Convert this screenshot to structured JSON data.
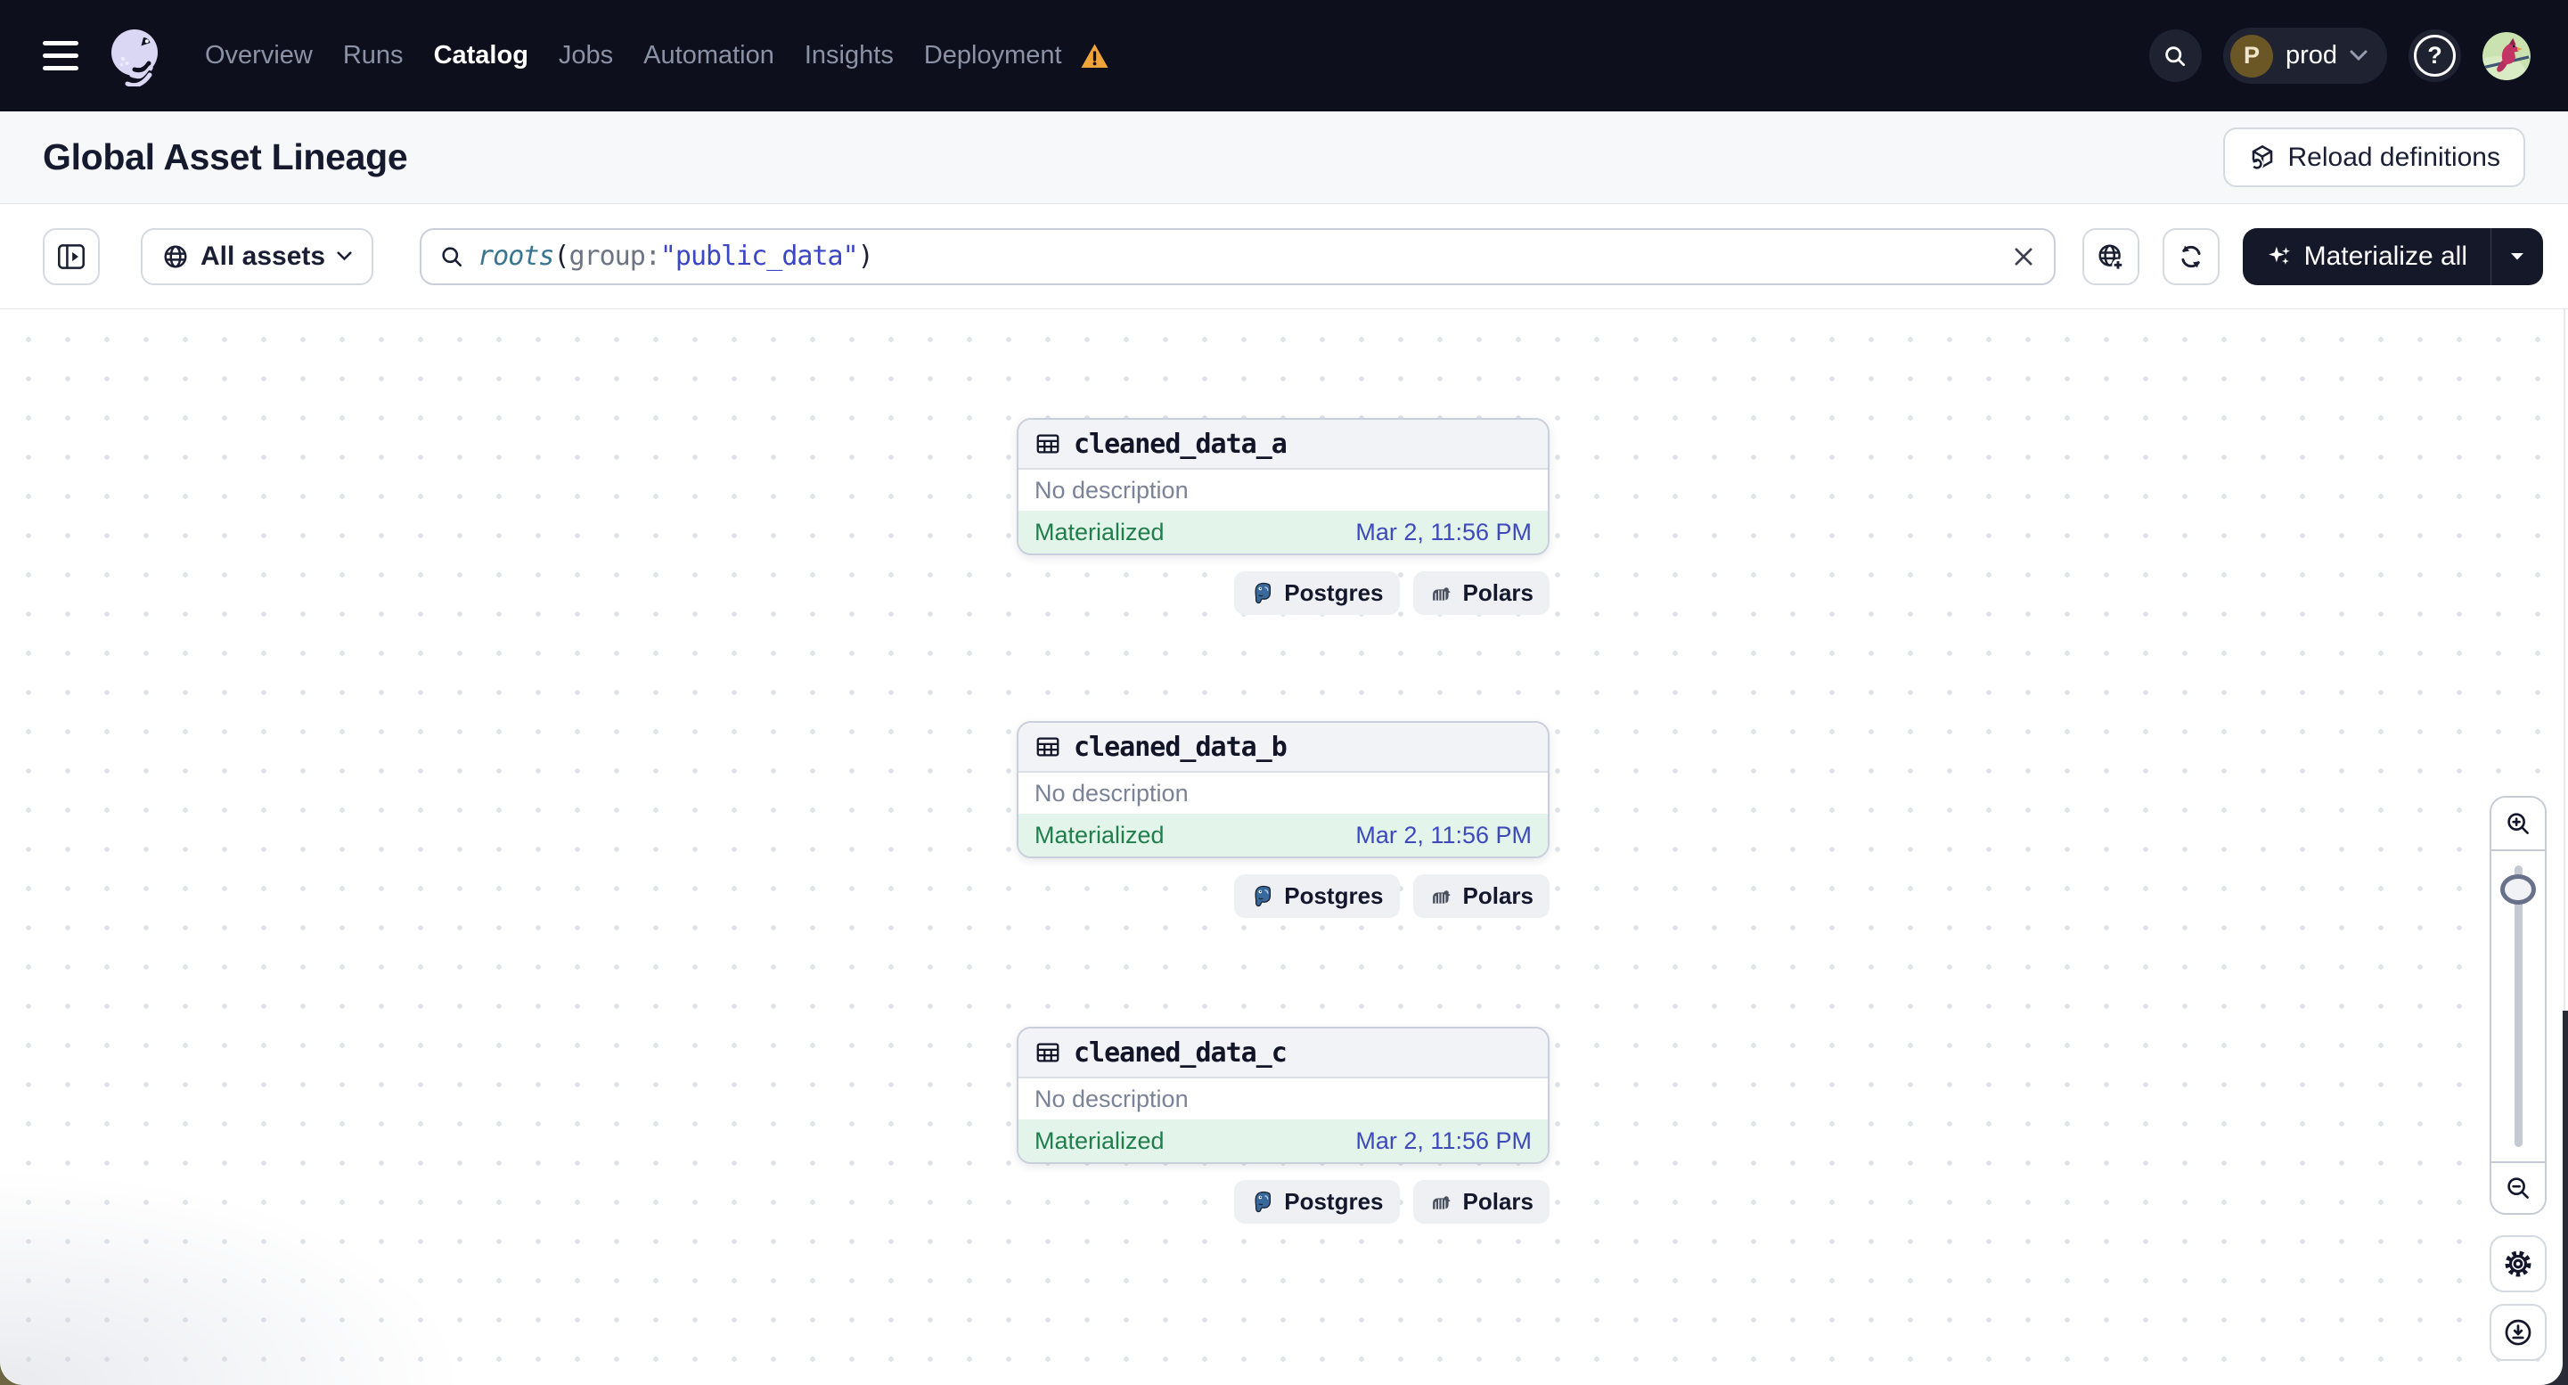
{
  "topnav": {
    "nav_items": [
      {
        "label": "Overview"
      },
      {
        "label": "Runs"
      },
      {
        "label": "Catalog"
      },
      {
        "label": "Jobs"
      },
      {
        "label": "Automation"
      },
      {
        "label": "Insights"
      },
      {
        "label": "Deployment"
      }
    ],
    "active_item": "Catalog",
    "project_badge": {
      "initial": "P",
      "name": "prod"
    },
    "help_label": "?"
  },
  "page_header": {
    "title": "Global Asset Lineage",
    "reload_button": "Reload definitions"
  },
  "toolbar": {
    "asset_filter_label": "All assets",
    "search": {
      "query_fn": "roots",
      "query_open": "(",
      "query_field": "group:",
      "query_value": "\"public_data\"",
      "query_close": ")"
    },
    "materialize_label": "Materialize all"
  },
  "graph": {
    "nodes": [
      {
        "title": "cleaned_data_a",
        "description": "No description",
        "status": "Materialized",
        "timestamp": "Mar 2, 11:56 PM",
        "tags": [
          "Postgres",
          "Polars"
        ]
      },
      {
        "title": "cleaned_data_b",
        "description": "No description",
        "status": "Materialized",
        "timestamp": "Mar 2, 11:56 PM",
        "tags": [
          "Postgres",
          "Polars"
        ]
      },
      {
        "title": "cleaned_data_c",
        "description": "No description",
        "status": "Materialized",
        "timestamp": "Mar 2, 11:56 PM",
        "tags": [
          "Postgres",
          "Polars"
        ]
      }
    ]
  },
  "colors": {
    "nav_bg": "#0D0F1D",
    "status_green": "#1F7E4C",
    "timestamp_blue": "#3D49BC",
    "warning_amber": "#EFA43A",
    "materialize_bg": "#151828"
  }
}
